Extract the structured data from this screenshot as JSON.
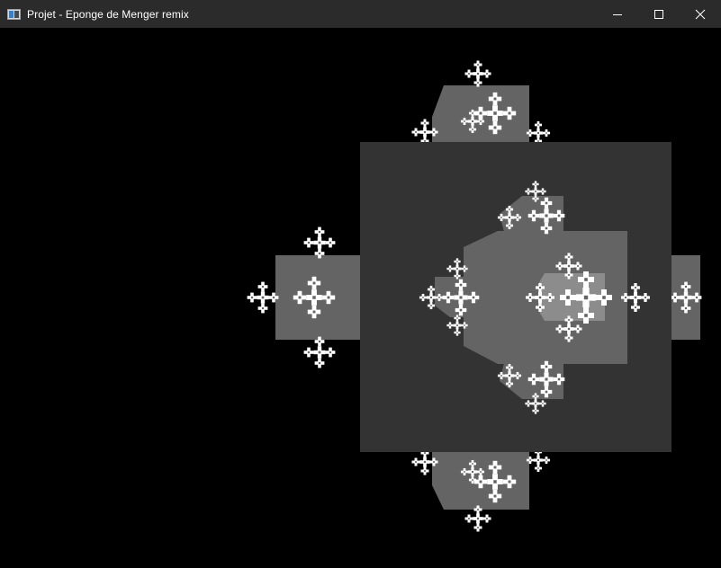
{
  "window": {
    "title": "Projet - Eponge de Menger remix",
    "controls": {
      "minimize": "minimize",
      "maximize": "maximize",
      "close": "close"
    }
  },
  "scene": {
    "background": "#000000",
    "render": "Menger sponge fractal, 3D view",
    "colors": {
      "front_face": "#333333",
      "side_face": "#646464",
      "inner_face": "#8c8c8c",
      "highlight": "#ffffff"
    }
  }
}
